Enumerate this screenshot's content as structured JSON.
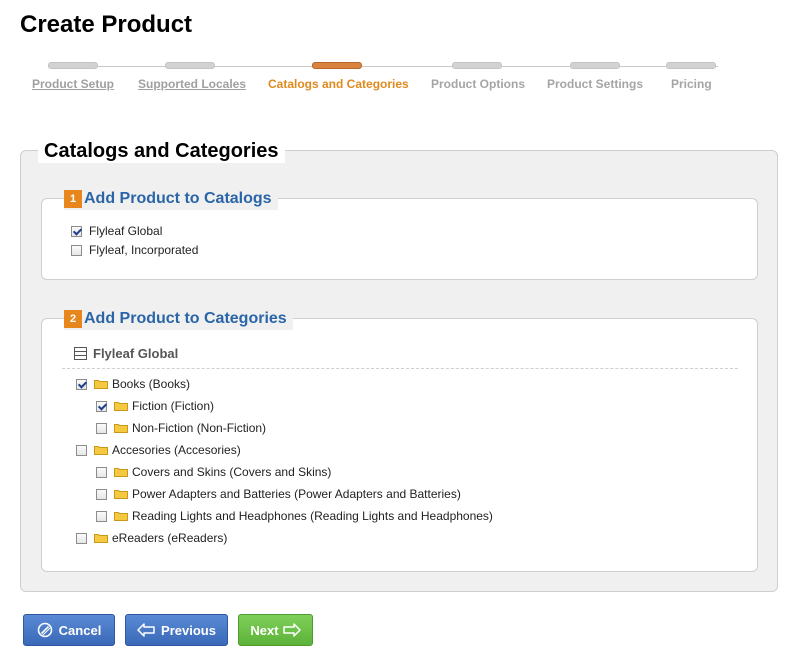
{
  "page": {
    "title": "Create Product"
  },
  "steps": [
    {
      "label": "Product Setup",
      "state": "link"
    },
    {
      "label": "Supported Locales",
      "state": "link"
    },
    {
      "label": "Catalogs and Categories",
      "state": "active"
    },
    {
      "label": "Product Options",
      "state": "inactive"
    },
    {
      "label": "Product Settings",
      "state": "inactive"
    },
    {
      "label": "Pricing",
      "state": "inactive"
    }
  ],
  "main": {
    "legend": "Catalogs and Categories"
  },
  "catalogs": {
    "badge": "1",
    "title": "Add Product to Catalogs",
    "items": [
      {
        "label": "Flyleaf Global",
        "checked": true
      },
      {
        "label": "Flyleaf, Incorporated",
        "checked": false
      }
    ]
  },
  "categories": {
    "badge": "2",
    "title": "Add Product to Categories",
    "tree_title": "Flyleaf Global",
    "items": [
      {
        "label": "Books (Books)",
        "checked": true,
        "level": 0
      },
      {
        "label": "Fiction (Fiction)",
        "checked": true,
        "level": 1
      },
      {
        "label": "Non-Fiction (Non-Fiction)",
        "checked": false,
        "level": 1
      },
      {
        "label": "Accesories (Accesories)",
        "checked": false,
        "level": 0
      },
      {
        "label": "Covers and Skins (Covers and Skins)",
        "checked": false,
        "level": 1
      },
      {
        "label": "Power Adapters and Batteries (Power Adapters and Batteries)",
        "checked": false,
        "level": 1
      },
      {
        "label": "Reading Lights and Headphones (Reading Lights and Headphones)",
        "checked": false,
        "level": 1
      },
      {
        "label": "eReaders (eReaders)",
        "checked": false,
        "level": 0
      }
    ]
  },
  "buttons": {
    "cancel": "Cancel",
    "previous": "Previous",
    "next": "Next"
  },
  "colors": {
    "accent": "#e08a1e",
    "section_title": "#2a65a8",
    "button_blue": "#3a69b8",
    "button_green": "#5cb238"
  },
  "icons": {
    "cancel": "cancel-circle-icon",
    "previous": "arrow-left-icon",
    "next": "arrow-right-icon",
    "folder": "folder-icon",
    "tree": "tree-list-icon"
  }
}
